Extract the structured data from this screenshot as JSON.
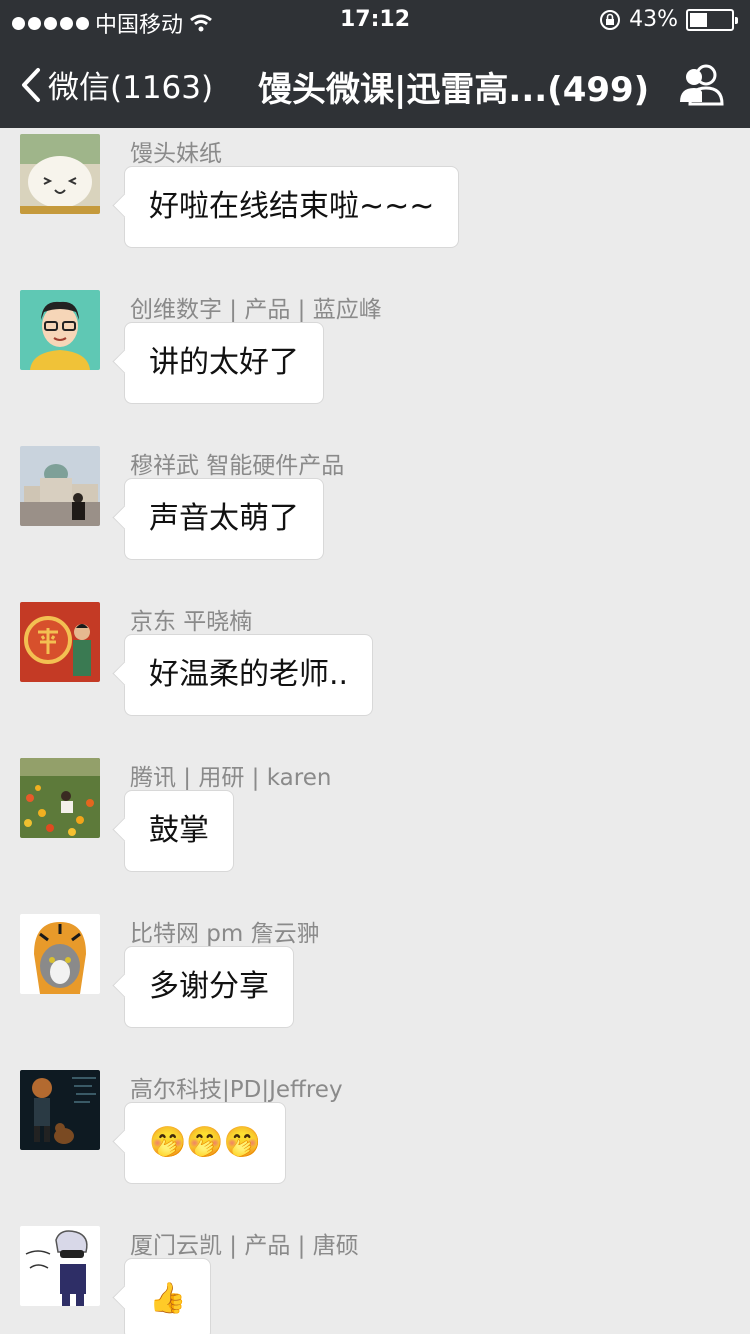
{
  "status_bar": {
    "carrier": "中国移动",
    "time": "17:12",
    "battery_percent_label": "43%",
    "battery_level": 0.43
  },
  "nav": {
    "back_label": "微信(1163)",
    "title": "馒头微课|迅雷高...(499)",
    "group_icon": "group-members-icon"
  },
  "messages": [
    {
      "sender": "馒头妹纸",
      "text": "好啦在线结束啦~~~",
      "avatar": "bun-mascot"
    },
    {
      "sender": "创维数字 | 产品 | 蓝应峰",
      "text": "讲的太好了",
      "avatar": "cartoon-man-glasses"
    },
    {
      "sender": "穆祥武  智能硬件产品",
      "text": "声音太萌了",
      "avatar": "man-in-front-of-domed-building"
    },
    {
      "sender": "京东 平晓楠",
      "text": "好温柔的老师..",
      "avatar": "man-beside-red-ping-sign"
    },
    {
      "sender": "腾讯 | 用研 | karen",
      "text": "鼓掌",
      "avatar": "woman-in-flower-field"
    },
    {
      "sender": "比特网 pm 詹云翀",
      "text": "多谢分享",
      "avatar": "cat-in-tiger-hood"
    },
    {
      "sender": "高尔科技|PD|Jeffrey",
      "text": "🤭🤭🤭",
      "avatar": "boy-with-teddy-bear"
    },
    {
      "sender": "厦门云凯 | 产品 | 唐硕",
      "text": "👍",
      "avatar": "sketched-boy-share-one"
    }
  ],
  "colors": {
    "header_bg": "#2f3236",
    "chat_bg": "#ebebeb",
    "bubble_bg": "#ffffff",
    "sender_text": "#8a8a8a"
  }
}
